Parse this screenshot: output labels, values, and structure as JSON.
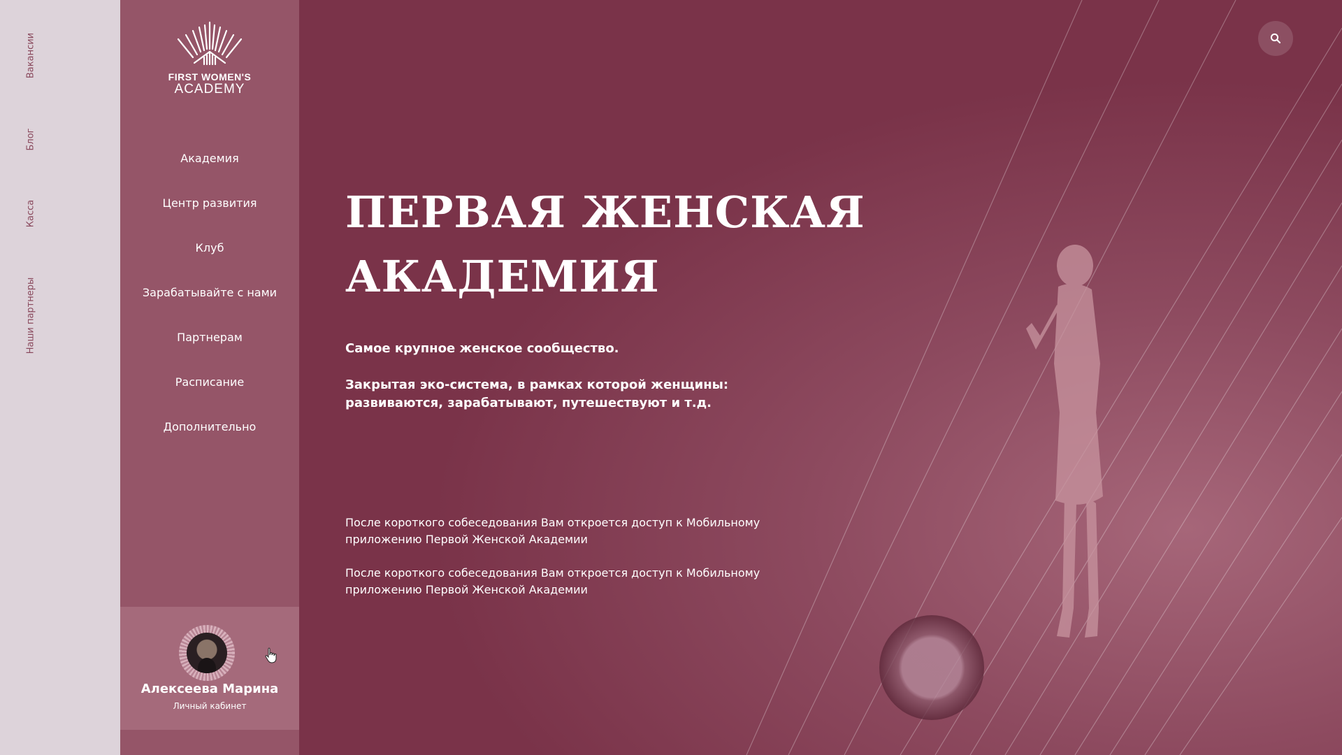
{
  "side_links": [
    "Вакансии",
    "Блог",
    "Касса",
    "Наши партнеры"
  ],
  "logo": {
    "line1": "FIRST WOMEN'S",
    "line2": "ACADEMY",
    "icon": "crown-icon"
  },
  "nav": {
    "items": [
      {
        "label": "Академия"
      },
      {
        "label": "Центр развития"
      },
      {
        "label": "Клуб"
      },
      {
        "label": "Зарабатывайте с нами"
      },
      {
        "label": "Партнерам"
      },
      {
        "label": "Расписание"
      },
      {
        "label": "Дополнительно"
      }
    ]
  },
  "user": {
    "name": "Алексеева Марина",
    "subtitle": "Личный кабинет"
  },
  "hero": {
    "title_line1": "ПЕРВАЯ ЖЕНСКАЯ",
    "title_line2": "АКАДЕМИЯ",
    "lead": "Самое крупное женское сообщество.",
    "lead2": "Закрытая эко-система, в рамках которой женщины: развиваются, зарабатывают, путешествуют и т.д.",
    "notes": [
      "После короткого собеседования Вам откроется доступ к Мобильному приложению Первой Женской Академии",
      "После короткого собеседования Вам откроется доступ к Мобильному приложению Первой Женской Академии"
    ]
  },
  "icons": {
    "search": "search-icon"
  },
  "colors": {
    "brand": "#7a3349",
    "nav_bg": "#955568",
    "strip_bg": "#ddd3da",
    "user_box": "#a56a7b"
  }
}
